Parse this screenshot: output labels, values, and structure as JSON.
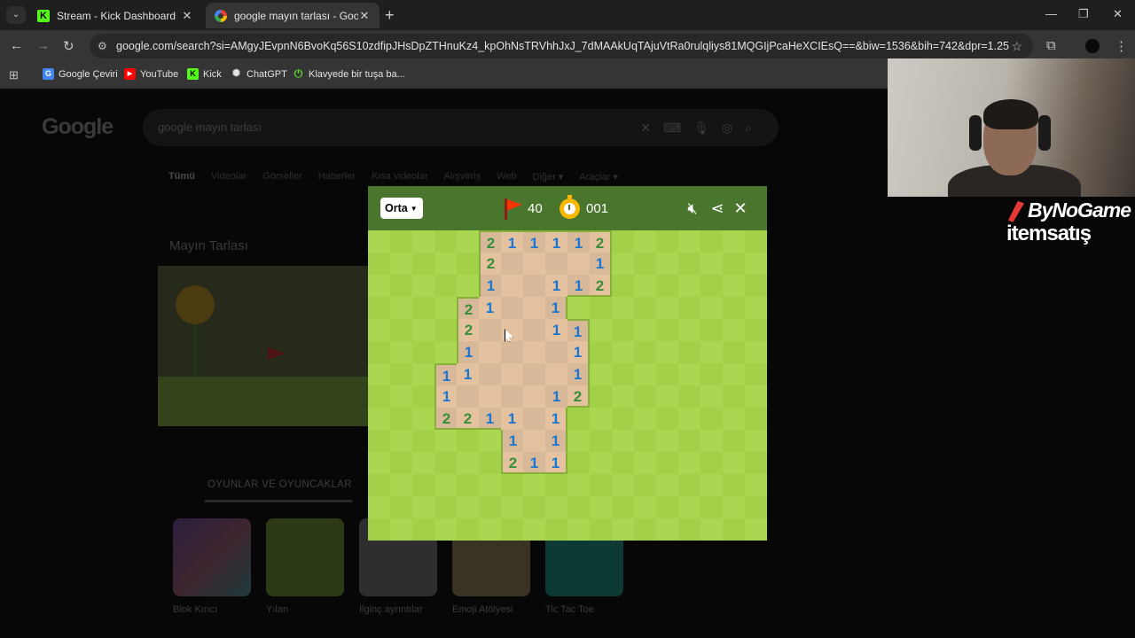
{
  "browser": {
    "tabs": [
      {
        "title": "Stream - Kick Dashboard",
        "active": false
      },
      {
        "title": "google mayın tarlası - Google'da",
        "active": true
      }
    ],
    "url": "google.com/search?si=AMgyJEvpnN6BvoKq56S10zdfipJHsDpZTHnuKz4_kpOhNsTRVhhJxJ_7dMAAkUqTAjuVtRa0rulqliys81MQGIjPcaHeXCIEsQ==&biw=1536&bih=742&dpr=1.25",
    "bookmarks": [
      {
        "label": "Google Çeviri"
      },
      {
        "label": "YouTube"
      },
      {
        "label": "Kick"
      },
      {
        "label": "ChatGPT"
      },
      {
        "label": "Klavyede bir tuşa ba..."
      }
    ]
  },
  "google": {
    "logo": "Google",
    "query": "google mayın tarlası",
    "tabs": [
      "Tümü",
      "Videolar",
      "Görseller",
      "Haberler",
      "Kısa videolar",
      "Alışveriş",
      "Web",
      "Diğer ▾",
      "Araçlar ▾"
    ],
    "panel_title": "Mayın Tarlası",
    "toys_heading": "OYUNLAR VE OYUNCAKLAR",
    "cards": [
      "Blok Kırıcı",
      "Yılan",
      "İlginç ayrıntılar",
      "Emoji Atölyesi",
      "Tic Tac Toe"
    ]
  },
  "game": {
    "difficulty": "Orta",
    "flags": "40",
    "timer": "001",
    "colors": {
      "header": "#4a752c",
      "light_green": "#aad751",
      "dark_green": "#a2d149",
      "light_dirt": "#e5c29f",
      "dark_dirt": "#d7b899",
      "one": "#1976d2",
      "two": "#388e3c"
    },
    "grid": {
      "cols": 18,
      "rows": 14,
      "revealed": [
        [
          0,
          5,
          "2"
        ],
        [
          0,
          6,
          "1"
        ],
        [
          0,
          7,
          "1"
        ],
        [
          0,
          8,
          "1"
        ],
        [
          0,
          9,
          "1"
        ],
        [
          0,
          10,
          "2"
        ],
        [
          1,
          5,
          "2"
        ],
        [
          1,
          6,
          ""
        ],
        [
          1,
          7,
          ""
        ],
        [
          1,
          8,
          ""
        ],
        [
          1,
          9,
          ""
        ],
        [
          1,
          10,
          "1"
        ],
        [
          2,
          5,
          "1"
        ],
        [
          2,
          6,
          ""
        ],
        [
          2,
          7,
          ""
        ],
        [
          2,
          8,
          "1"
        ],
        [
          2,
          9,
          "1"
        ],
        [
          2,
          10,
          "2"
        ],
        [
          3,
          4,
          "2"
        ],
        [
          3,
          5,
          "1"
        ],
        [
          3,
          6,
          ""
        ],
        [
          3,
          7,
          ""
        ],
        [
          3,
          8,
          "1"
        ],
        [
          4,
          4,
          "2"
        ],
        [
          4,
          5,
          ""
        ],
        [
          4,
          6,
          ""
        ],
        [
          4,
          7,
          ""
        ],
        [
          4,
          8,
          "1"
        ],
        [
          4,
          9,
          "1"
        ],
        [
          5,
          4,
          "1"
        ],
        [
          5,
          5,
          ""
        ],
        [
          5,
          6,
          ""
        ],
        [
          5,
          7,
          ""
        ],
        [
          5,
          8,
          ""
        ],
        [
          5,
          9,
          "1"
        ],
        [
          6,
          3,
          "1"
        ],
        [
          6,
          4,
          "1"
        ],
        [
          6,
          5,
          ""
        ],
        [
          6,
          6,
          ""
        ],
        [
          6,
          7,
          ""
        ],
        [
          6,
          8,
          ""
        ],
        [
          6,
          9,
          "1"
        ],
        [
          7,
          3,
          "1"
        ],
        [
          7,
          4,
          ""
        ],
        [
          7,
          5,
          ""
        ],
        [
          7,
          6,
          ""
        ],
        [
          7,
          7,
          ""
        ],
        [
          7,
          8,
          "1"
        ],
        [
          7,
          9,
          "2"
        ],
        [
          8,
          3,
          "2"
        ],
        [
          8,
          4,
          "2"
        ],
        [
          8,
          5,
          "1"
        ],
        [
          8,
          6,
          "1"
        ],
        [
          8,
          7,
          ""
        ],
        [
          8,
          8,
          "1"
        ],
        [
          9,
          6,
          "1"
        ],
        [
          9,
          7,
          ""
        ],
        [
          9,
          8,
          "1"
        ],
        [
          10,
          6,
          "2"
        ],
        [
          10,
          7,
          "1"
        ],
        [
          10,
          8,
          "1"
        ]
      ]
    }
  },
  "overlay": {
    "brand1": "ByNoGame",
    "brand2": "itemsatış"
  }
}
